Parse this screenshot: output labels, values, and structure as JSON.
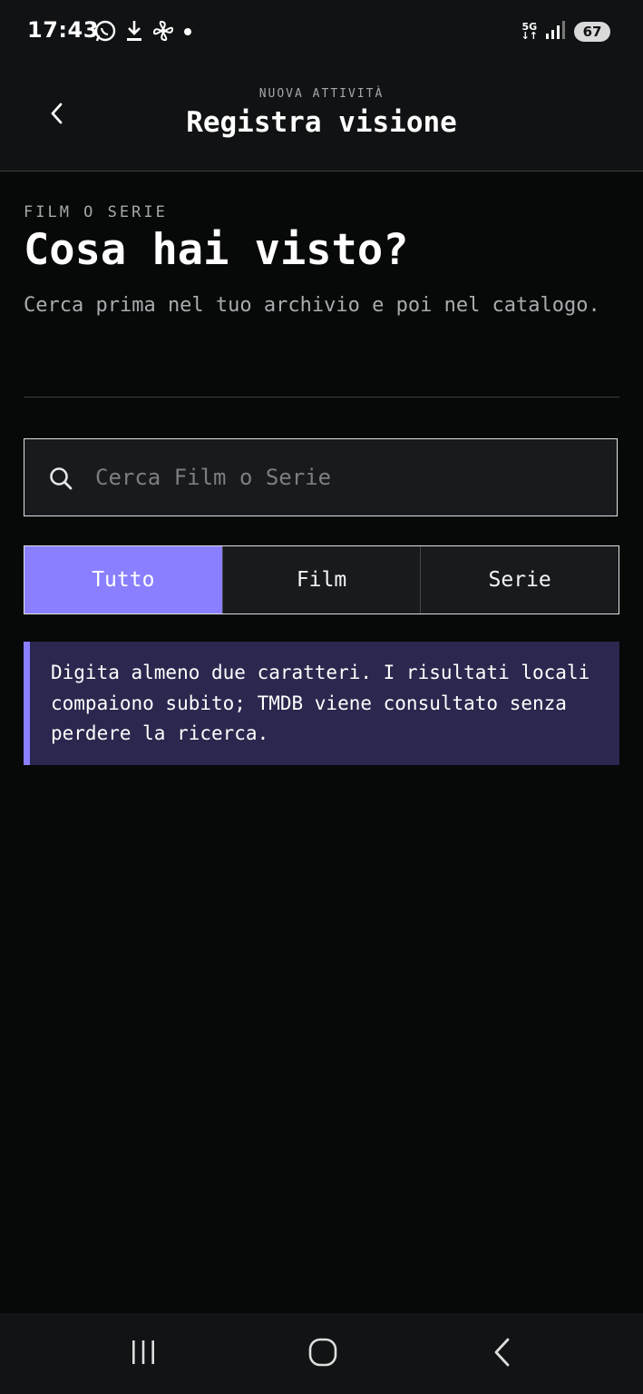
{
  "status_bar": {
    "time": "17:43",
    "left_icons": [
      "whatsapp-icon",
      "download-icon",
      "fan-icon",
      "dot-icon"
    ],
    "network": "5G",
    "battery": "67"
  },
  "header": {
    "eyebrow": "NUOVA ATTIVITÀ",
    "title": "Registra visione",
    "back_icon": "chevron-left-icon"
  },
  "content": {
    "eyebrow": "FILM O SERIE",
    "heading": "Cosa hai visto?",
    "subtitle": "Cerca prima nel tuo archivio e poi nel catalogo."
  },
  "search": {
    "placeholder": "Cerca Film o Serie",
    "value": ""
  },
  "filters": {
    "options": [
      "Tutto",
      "Film",
      "Serie"
    ],
    "selected": "Tutto"
  },
  "info": {
    "text": "Digita almeno due caratteri. I risultati locali compaiono subito; TMDB viene consultato senza perdere la ricerca."
  },
  "colors": {
    "accent": "#8a80ff",
    "info_bg": "#2a284e",
    "background": "#070808",
    "surface": "#181a1d"
  }
}
